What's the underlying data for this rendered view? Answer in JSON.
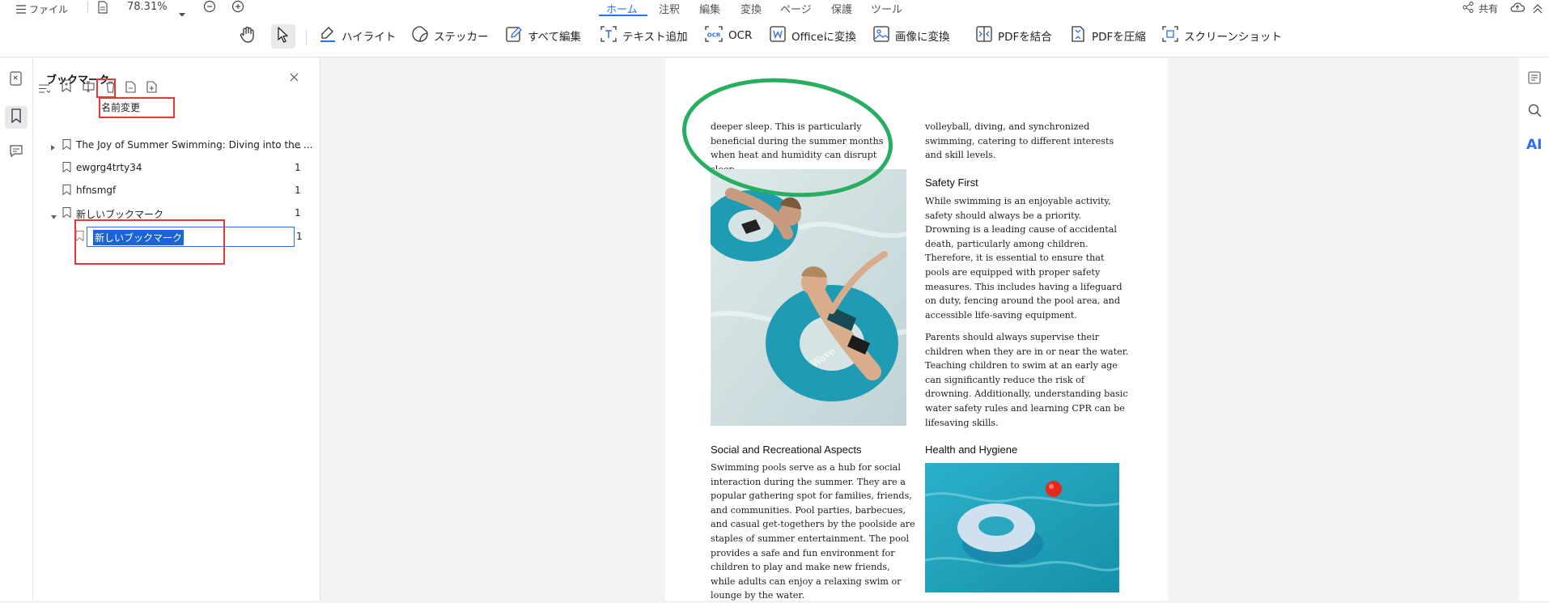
{
  "topbar": {
    "menu_label": "ファイル",
    "zoom": "78.31%",
    "tabs": [
      {
        "label": "ホーム",
        "active": true
      },
      {
        "label": "注釈"
      },
      {
        "label": "編集"
      },
      {
        "label": "変換"
      },
      {
        "label": "ページ"
      },
      {
        "label": "保護"
      },
      {
        "label": "ツール"
      }
    ],
    "share_label": "共有"
  },
  "toolbar": {
    "tools": [
      {
        "label": "ハイライト",
        "icon": "highlighter-icon"
      },
      {
        "label": "ステッカー",
        "icon": "sticker-icon"
      },
      {
        "label": "すべて編集",
        "icon": "edit-all-icon"
      },
      {
        "label": "テキスト追加",
        "icon": "add-text-icon"
      },
      {
        "label": "OCR",
        "icon": "ocr-icon"
      },
      {
        "label": "Officeに変換",
        "icon": "convert-office-icon"
      },
      {
        "label": "画像に変換",
        "icon": "convert-image-icon"
      },
      {
        "label": "PDFを結合",
        "icon": "merge-pdf-icon"
      },
      {
        "label": "PDFを圧縮",
        "icon": "compress-pdf-icon"
      },
      {
        "label": "スクリーンショット",
        "icon": "screenshot-icon"
      }
    ]
  },
  "bookmark_panel": {
    "title": "ブックマーク",
    "tooltip": "名前変更",
    "items": [
      {
        "label": "The Joy of Summer Swimming: Diving into the ...",
        "page": "...",
        "expandable": true,
        "expanded": false
      },
      {
        "label": "ewgrg4trty34",
        "page": "1"
      },
      {
        "label": "hfnsmgf",
        "page": "1"
      },
      {
        "label": "新しいブックマーク",
        "page": "1",
        "expandable": true,
        "expanded": true
      }
    ],
    "editing_item": {
      "value": "新しいブックマーク",
      "page": "1"
    }
  },
  "document": {
    "left_col_intro": "deeper sleep. This is particularly beneficial during the summer months when heat and humidity can disrupt sleep.",
    "right_col_intro": "volleyball, diving, and synchronized swimming, catering to different interests and skill levels.",
    "safety_heading": "Safety First",
    "safety_p1": "While swimming is an enjoyable activity, safety should always be a priority. Drowning is a leading cause of accidental death, particularly among children. Therefore, it is essential to ensure that pools are equipped with proper safety measures. This includes having a lifeguard on duty, fencing around the pool area, and accessible life-saving equipment.",
    "safety_p2": "Parents should always supervise their children when they are in or near the water. Teaching children to swim at an early age can significantly reduce the risk of drowning. Additionally, understanding basic water safety rules and learning CPR can be lifesaving skills.",
    "social_heading": "Social and Recreational Aspects",
    "social_p1": "Swimming pools serve as a hub for social interaction during the summer. They are a popular gathering spot for families, friends, and communities. Pool parties, barbecues, and casual get-togethers by the poolside are staples of summer entertainment. The pool provides a safe and fun environment for children to play and make new friends, while adults can enjoy a relaxing swim or lounge by the water.",
    "health_heading": "Health and Hygiene",
    "tube_text": "Wave"
  },
  "colors": {
    "accent": "#2a6ef2",
    "annotation_red": "#e53935",
    "annotation_green": "#27ae60",
    "pool_teal": "#1f9bb3"
  }
}
